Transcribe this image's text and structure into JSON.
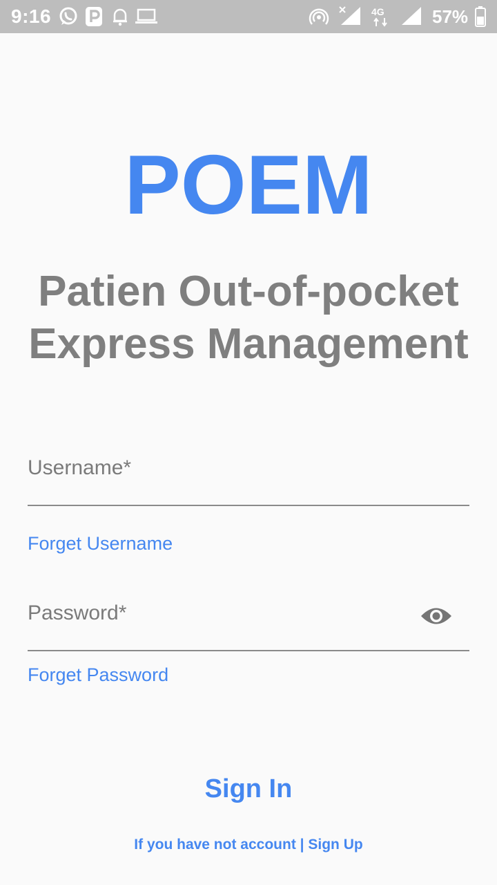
{
  "status_bar": {
    "time": "9:16",
    "battery": "57%",
    "network": "4G",
    "icons": [
      "whatsapp-icon",
      "parking-p-icon",
      "bell-icon",
      "laptop-icon",
      "hotspot-icon",
      "signal-x-icon",
      "network-4g-icon",
      "signal-icon",
      "battery-icon"
    ]
  },
  "header": {
    "app_name": "POEM",
    "subtitle_line1": "Patien Out-of-pocket",
    "subtitle_line2": "Express Management"
  },
  "form": {
    "username_label": "Username*",
    "forget_username": "Forget Username",
    "password_label": "Password*",
    "forget_password": "Forget Password",
    "sign_in": "Sign In",
    "signup_prompt": "If you have not account",
    "signup_separator": "|",
    "signup_link": "Sign Up"
  },
  "colors": {
    "accent": "#4587f0",
    "subtitle": "#7f7f7f",
    "status_bar": "#bdbdbd",
    "background": "#fafafa"
  }
}
